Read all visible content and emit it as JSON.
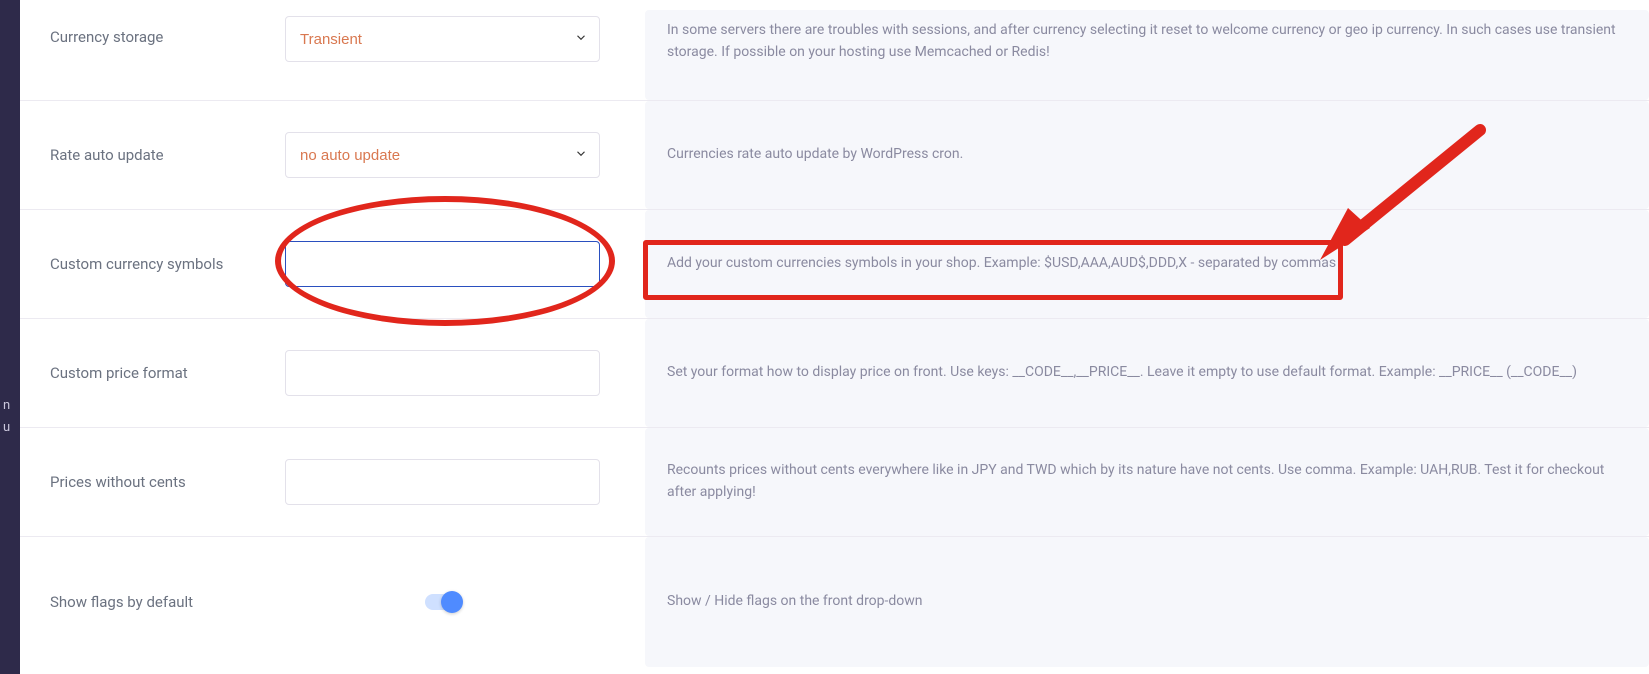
{
  "sidebar": {
    "letters": [
      "n",
      "u"
    ]
  },
  "rows": {
    "storage": {
      "label": "Currency storage",
      "value": "Transient",
      "desc": "In some servers there are troubles with sessions, and after currency selecting it reset to welcome currency or geo ip currency. In such cases use transient storage. If possible on your hosting use Memcached or Redis!"
    },
    "rate": {
      "label": "Rate auto update",
      "value": "no auto update",
      "desc": "Currencies rate auto update by WordPress cron."
    },
    "symbols": {
      "label": "Custom currency symbols",
      "value": "",
      "desc": "Add your custom currencies symbols in your shop. Example: $USD,AAA,AUD$,DDD,X - separated by commas"
    },
    "format": {
      "label": "Custom price format",
      "value": "",
      "desc": "Set your format how to display price on front. Use keys: __CODE__,__PRICE__. Leave it empty to use default format. Example: __PRICE__ (__CODE__)"
    },
    "nocents": {
      "label": "Prices without cents",
      "value": "",
      "desc": "Recounts prices without cents everywhere like in JPY and TWD which by its nature have not cents. Use comma. Example: UAH,RUB. Test it for checkout after applying!"
    },
    "flags": {
      "label": "Show flags by default",
      "desc": "Show / Hide flags on the front drop-down"
    }
  }
}
